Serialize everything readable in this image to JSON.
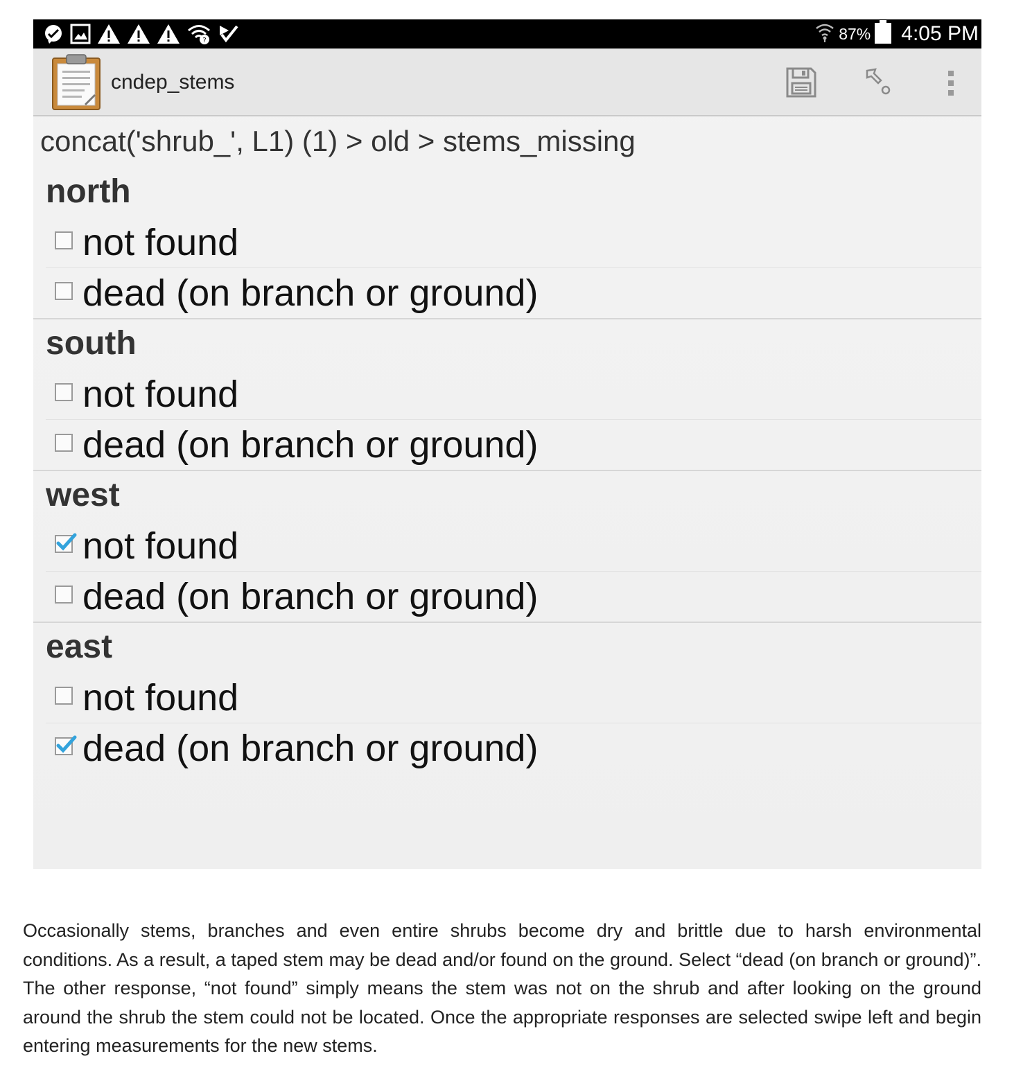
{
  "status_bar": {
    "battery_percent": "87%",
    "clock": "4:05 PM"
  },
  "app": {
    "title": "cndep_stems"
  },
  "breadcrumb": "concat('shrub_', L1) (1) > old > stems_missing",
  "groups": [
    {
      "label": "north",
      "options": [
        {
          "label": "not found",
          "checked": false
        },
        {
          "label": "dead (on branch or ground)",
          "checked": false
        }
      ]
    },
    {
      "label": "south",
      "options": [
        {
          "label": "not found",
          "checked": false
        },
        {
          "label": "dead (on branch or ground)",
          "checked": false
        }
      ]
    },
    {
      "label": "west",
      "options": [
        {
          "label": "not found",
          "checked": true
        },
        {
          "label": "dead (on branch or ground)",
          "checked": false
        }
      ]
    },
    {
      "label": "east",
      "options": [
        {
          "label": "not found",
          "checked": false
        },
        {
          "label": "dead (on branch or ground)",
          "checked": true
        }
      ]
    }
  ],
  "description": "Occasionally stems, branches and even entire shrubs become dry and brittle due to harsh environmental conditions.  As a result, a taped stem may be dead and/or found on the ground.  Select “dead (on branch or ground)”.  The other response, “not found” simply means the stem was not on the shrub and after looking on the ground around the shrub the stem could not be located.  Once the appropriate responses are selected swipe left and begin entering measurements for the new stems.",
  "colors": {
    "check_accent": "#33a3dc",
    "status_bar": "#000000",
    "action_bar": "#e6e6e6"
  },
  "icons": {
    "status_left": [
      "messenger-icon",
      "gallery-icon",
      "warning-icon",
      "warning-icon",
      "warning-icon",
      "wifi-unknown-icon",
      "checkmark-notification-icon"
    ],
    "status_right": [
      "wifi-icon",
      "battery-icon"
    ],
    "action_bar": [
      "form-clipboard-icon",
      "save-icon",
      "go-to-prompt-icon",
      "overflow-menu-icon"
    ]
  }
}
